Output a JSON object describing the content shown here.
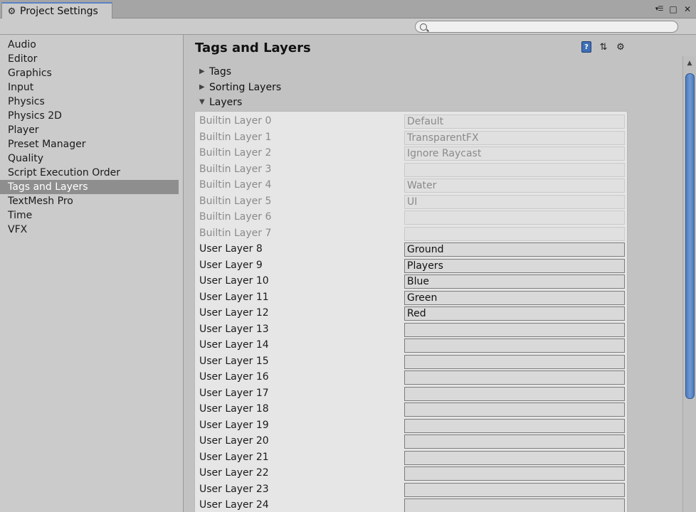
{
  "window": {
    "tab_title": "Project Settings",
    "controls": [
      "menu-icon",
      "maximize-icon",
      "close-icon"
    ]
  },
  "search": {
    "value": "",
    "placeholder": ""
  },
  "sidebar": {
    "items": [
      {
        "label": "Audio"
      },
      {
        "label": "Editor"
      },
      {
        "label": "Graphics"
      },
      {
        "label": "Input"
      },
      {
        "label": "Physics"
      },
      {
        "label": "Physics 2D"
      },
      {
        "label": "Player"
      },
      {
        "label": "Preset Manager"
      },
      {
        "label": "Quality"
      },
      {
        "label": "Script Execution Order"
      },
      {
        "label": "Tags and Layers",
        "selected": true
      },
      {
        "label": "TextMesh Pro"
      },
      {
        "label": "Time"
      },
      {
        "label": "VFX"
      }
    ]
  },
  "main": {
    "title": "Tags and Layers",
    "foldouts": {
      "tags": "Tags",
      "sorting_layers": "Sorting Layers",
      "layers": "Layers"
    },
    "layers": [
      {
        "label": "Builtin Layer 0",
        "value": "Default",
        "builtin": true
      },
      {
        "label": "Builtin Layer 1",
        "value": "TransparentFX",
        "builtin": true
      },
      {
        "label": "Builtin Layer 2",
        "value": "Ignore Raycast",
        "builtin": true
      },
      {
        "label": "Builtin Layer 3",
        "value": "",
        "builtin": true
      },
      {
        "label": "Builtin Layer 4",
        "value": "Water",
        "builtin": true
      },
      {
        "label": "Builtin Layer 5",
        "value": "UI",
        "builtin": true
      },
      {
        "label": "Builtin Layer 6",
        "value": "",
        "builtin": true
      },
      {
        "label": "Builtin Layer 7",
        "value": "",
        "builtin": true
      },
      {
        "label": "User Layer 8",
        "value": "Ground",
        "builtin": false
      },
      {
        "label": "User Layer 9",
        "value": "Players",
        "builtin": false
      },
      {
        "label": "User Layer 10",
        "value": "Blue",
        "builtin": false
      },
      {
        "label": "User Layer 11",
        "value": "Green",
        "builtin": false
      },
      {
        "label": "User Layer 12",
        "value": "Red",
        "builtin": false
      },
      {
        "label": "User Layer 13",
        "value": "",
        "builtin": false
      },
      {
        "label": "User Layer 14",
        "value": "",
        "builtin": false
      },
      {
        "label": "User Layer 15",
        "value": "",
        "builtin": false
      },
      {
        "label": "User Layer 16",
        "value": "",
        "builtin": false
      },
      {
        "label": "User Layer 17",
        "value": "",
        "builtin": false
      },
      {
        "label": "User Layer 18",
        "value": "",
        "builtin": false
      },
      {
        "label": "User Layer 19",
        "value": "",
        "builtin": false
      },
      {
        "label": "User Layer 20",
        "value": "",
        "builtin": false
      },
      {
        "label": "User Layer 21",
        "value": "",
        "builtin": false
      },
      {
        "label": "User Layer 22",
        "value": "",
        "builtin": false
      },
      {
        "label": "User Layer 23",
        "value": "",
        "builtin": false
      },
      {
        "label": "User Layer 24",
        "value": "",
        "builtin": false
      }
    ]
  },
  "colors": {
    "selection": "#8e8e8e",
    "scroll_thumb": "#5b86c4",
    "tab_accent": "#5a82c4"
  }
}
